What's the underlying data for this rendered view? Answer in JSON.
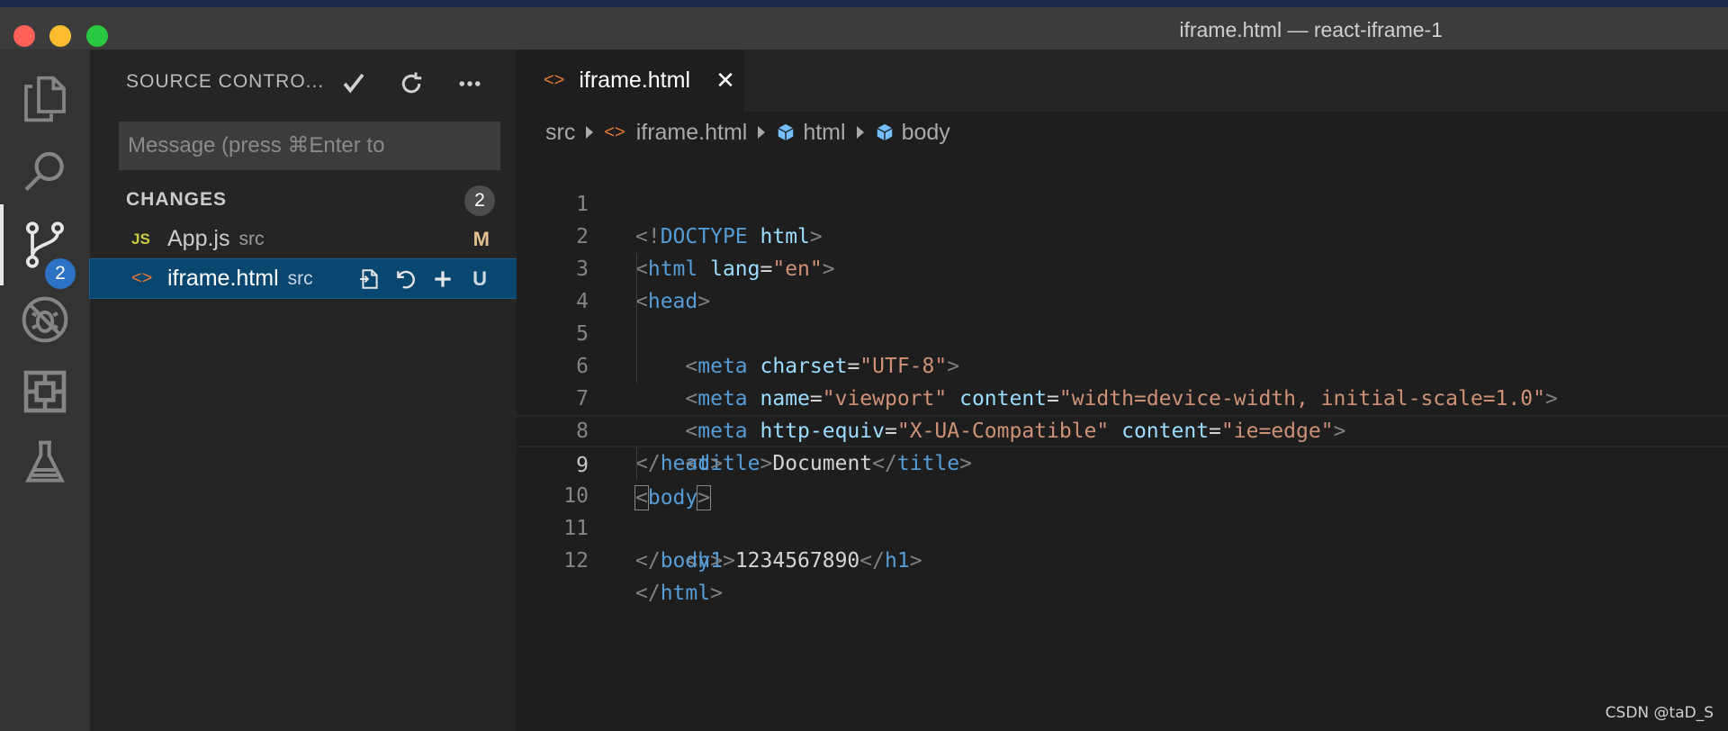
{
  "window": {
    "title": "iframe.html — react-iframe-1"
  },
  "activity_bar": {
    "items": [
      {
        "name": "explorer",
        "icon": "files-icon"
      },
      {
        "name": "search",
        "icon": "search-icon"
      },
      {
        "name": "source-control",
        "icon": "source-control-icon",
        "badge": "2",
        "active": true
      },
      {
        "name": "debug",
        "icon": "debug-icon"
      },
      {
        "name": "extensions",
        "icon": "extensions-icon"
      },
      {
        "name": "testing",
        "icon": "flask-icon"
      }
    ]
  },
  "sidebar": {
    "title": "SOURCE CONTRO...",
    "commit_placeholder": "Message (press ⌘Enter to",
    "changes_header": "CHANGES",
    "changes_count": "2",
    "files": [
      {
        "icon": "JS",
        "name": "App.js",
        "dir": "src",
        "status": "M"
      },
      {
        "icon": "<>",
        "name": "iframe.html",
        "dir": "src",
        "status": "U",
        "selected": true
      }
    ]
  },
  "editor": {
    "tab": {
      "icon": "<>",
      "label": "iframe.html",
      "close": "✕"
    },
    "breadcrumb": [
      "src",
      "iframe.html",
      "html",
      "body"
    ],
    "current_line": 9,
    "line_numbers": [
      "1",
      "2",
      "3",
      "4",
      "5",
      "6",
      "7",
      "8",
      "9",
      "10",
      "11",
      "12"
    ]
  },
  "colors": {
    "accent_badge": "#2c73c6",
    "selection": "#094771",
    "tag": "#569cd6",
    "attr": "#9cdcfe",
    "string": "#ce9178"
  },
  "watermark": "CSDN @taD_S"
}
